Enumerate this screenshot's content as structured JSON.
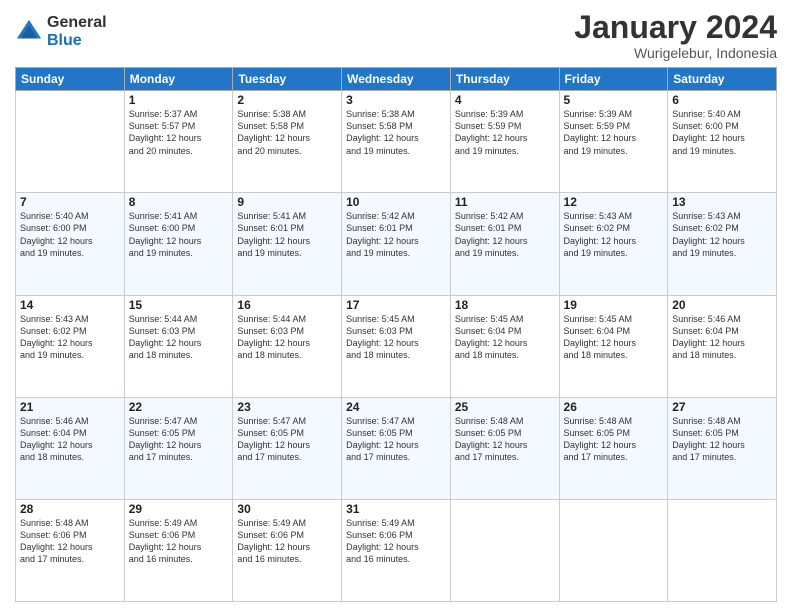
{
  "logo": {
    "general": "General",
    "blue": "Blue"
  },
  "title": "January 2024",
  "location": "Wurigelebur, Indonesia",
  "headers": [
    "Sunday",
    "Monday",
    "Tuesday",
    "Wednesday",
    "Thursday",
    "Friday",
    "Saturday"
  ],
  "weeks": [
    [
      {
        "day": "",
        "info": ""
      },
      {
        "day": "1",
        "info": "Sunrise: 5:37 AM\nSunset: 5:57 PM\nDaylight: 12 hours\nand 20 minutes."
      },
      {
        "day": "2",
        "info": "Sunrise: 5:38 AM\nSunset: 5:58 PM\nDaylight: 12 hours\nand 20 minutes."
      },
      {
        "day": "3",
        "info": "Sunrise: 5:38 AM\nSunset: 5:58 PM\nDaylight: 12 hours\nand 19 minutes."
      },
      {
        "day": "4",
        "info": "Sunrise: 5:39 AM\nSunset: 5:59 PM\nDaylight: 12 hours\nand 19 minutes."
      },
      {
        "day": "5",
        "info": "Sunrise: 5:39 AM\nSunset: 5:59 PM\nDaylight: 12 hours\nand 19 minutes."
      },
      {
        "day": "6",
        "info": "Sunrise: 5:40 AM\nSunset: 6:00 PM\nDaylight: 12 hours\nand 19 minutes."
      }
    ],
    [
      {
        "day": "7",
        "info": "Sunrise: 5:40 AM\nSunset: 6:00 PM\nDaylight: 12 hours\nand 19 minutes."
      },
      {
        "day": "8",
        "info": "Sunrise: 5:41 AM\nSunset: 6:00 PM\nDaylight: 12 hours\nand 19 minutes."
      },
      {
        "day": "9",
        "info": "Sunrise: 5:41 AM\nSunset: 6:01 PM\nDaylight: 12 hours\nand 19 minutes."
      },
      {
        "day": "10",
        "info": "Sunrise: 5:42 AM\nSunset: 6:01 PM\nDaylight: 12 hours\nand 19 minutes."
      },
      {
        "day": "11",
        "info": "Sunrise: 5:42 AM\nSunset: 6:01 PM\nDaylight: 12 hours\nand 19 minutes."
      },
      {
        "day": "12",
        "info": "Sunrise: 5:43 AM\nSunset: 6:02 PM\nDaylight: 12 hours\nand 19 minutes."
      },
      {
        "day": "13",
        "info": "Sunrise: 5:43 AM\nSunset: 6:02 PM\nDaylight: 12 hours\nand 19 minutes."
      }
    ],
    [
      {
        "day": "14",
        "info": "Sunrise: 5:43 AM\nSunset: 6:02 PM\nDaylight: 12 hours\nand 19 minutes."
      },
      {
        "day": "15",
        "info": "Sunrise: 5:44 AM\nSunset: 6:03 PM\nDaylight: 12 hours\nand 18 minutes."
      },
      {
        "day": "16",
        "info": "Sunrise: 5:44 AM\nSunset: 6:03 PM\nDaylight: 12 hours\nand 18 minutes."
      },
      {
        "day": "17",
        "info": "Sunrise: 5:45 AM\nSunset: 6:03 PM\nDaylight: 12 hours\nand 18 minutes."
      },
      {
        "day": "18",
        "info": "Sunrise: 5:45 AM\nSunset: 6:04 PM\nDaylight: 12 hours\nand 18 minutes."
      },
      {
        "day": "19",
        "info": "Sunrise: 5:45 AM\nSunset: 6:04 PM\nDaylight: 12 hours\nand 18 minutes."
      },
      {
        "day": "20",
        "info": "Sunrise: 5:46 AM\nSunset: 6:04 PM\nDaylight: 12 hours\nand 18 minutes."
      }
    ],
    [
      {
        "day": "21",
        "info": "Sunrise: 5:46 AM\nSunset: 6:04 PM\nDaylight: 12 hours\nand 18 minutes."
      },
      {
        "day": "22",
        "info": "Sunrise: 5:47 AM\nSunset: 6:05 PM\nDaylight: 12 hours\nand 17 minutes."
      },
      {
        "day": "23",
        "info": "Sunrise: 5:47 AM\nSunset: 6:05 PM\nDaylight: 12 hours\nand 17 minutes."
      },
      {
        "day": "24",
        "info": "Sunrise: 5:47 AM\nSunset: 6:05 PM\nDaylight: 12 hours\nand 17 minutes."
      },
      {
        "day": "25",
        "info": "Sunrise: 5:48 AM\nSunset: 6:05 PM\nDaylight: 12 hours\nand 17 minutes."
      },
      {
        "day": "26",
        "info": "Sunrise: 5:48 AM\nSunset: 6:05 PM\nDaylight: 12 hours\nand 17 minutes."
      },
      {
        "day": "27",
        "info": "Sunrise: 5:48 AM\nSunset: 6:05 PM\nDaylight: 12 hours\nand 17 minutes."
      }
    ],
    [
      {
        "day": "28",
        "info": "Sunrise: 5:48 AM\nSunset: 6:06 PM\nDaylight: 12 hours\nand 17 minutes."
      },
      {
        "day": "29",
        "info": "Sunrise: 5:49 AM\nSunset: 6:06 PM\nDaylight: 12 hours\nand 16 minutes."
      },
      {
        "day": "30",
        "info": "Sunrise: 5:49 AM\nSunset: 6:06 PM\nDaylight: 12 hours\nand 16 minutes."
      },
      {
        "day": "31",
        "info": "Sunrise: 5:49 AM\nSunset: 6:06 PM\nDaylight: 12 hours\nand 16 minutes."
      },
      {
        "day": "",
        "info": ""
      },
      {
        "day": "",
        "info": ""
      },
      {
        "day": "",
        "info": ""
      }
    ]
  ]
}
